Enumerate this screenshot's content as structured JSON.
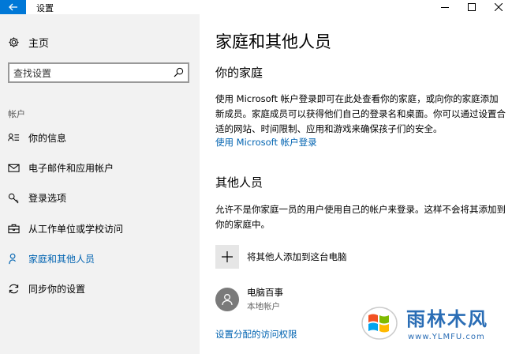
{
  "window": {
    "title": "设置"
  },
  "sidebar": {
    "home_label": "主页",
    "search_placeholder": "查找设置",
    "section_label": "帐户",
    "items": [
      {
        "label": "你的信息",
        "icon": "user-info-icon"
      },
      {
        "label": "电子邮件和应用帐户",
        "icon": "mail-icon"
      },
      {
        "label": "登录选项",
        "icon": "key-icon"
      },
      {
        "label": "从工作单位或学校访问",
        "icon": "briefcase-icon"
      },
      {
        "label": "家庭和其他人员",
        "icon": "person-icon",
        "active": true
      },
      {
        "label": "同步你的设置",
        "icon": "sync-icon"
      }
    ]
  },
  "main": {
    "title": "家庭和其他人员",
    "family": {
      "heading": "你的家庭",
      "description": "使用 Microsoft 帐户登录即可在此处查看你的家庭，或向你的家庭添加新成员。家庭成员可以获得他们自己的登录名和桌面。你可以通过设置合适的网站、时间限制、应用和游戏来确保孩子们的安全。",
      "link": "使用 Microsoft 帐户登录"
    },
    "others": {
      "heading": "其他人员",
      "description": "允许不是你家庭一员的用户使用自己的帐户来登录。这样不会将其添加到你的家庭中。",
      "add_label": "将其他人添加到这台电脑",
      "user_name": "电脑百事",
      "user_type": "本地帐户",
      "access_link": "设置分配的访问权限"
    }
  },
  "watermark": {
    "text": "雨林木风",
    "url": "www.YLMFU.com"
  },
  "colors": {
    "accent": "#0078d7",
    "link": "#0063b1",
    "sidebar_bg": "#f2f2f2"
  }
}
